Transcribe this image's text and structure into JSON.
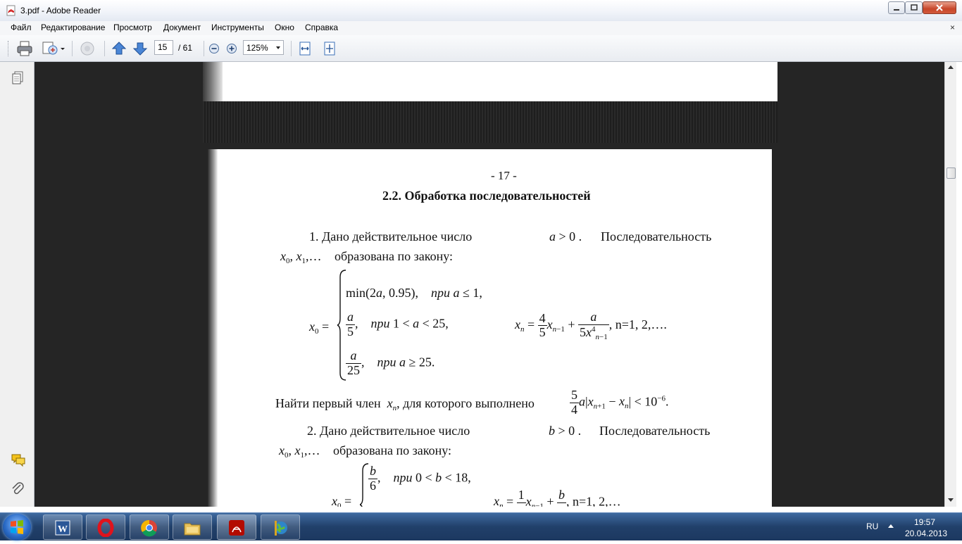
{
  "window": {
    "title": "3.pdf - Adobe Reader"
  },
  "menu": {
    "items": [
      "Файл",
      "Редактирование",
      "Просмотр",
      "Документ",
      "Инструменты",
      "Окно",
      "Справка"
    ],
    "close_glyph": "×"
  },
  "toolbar": {
    "page_current": "15",
    "page_total": "/ 61",
    "zoom": "125%",
    "icons": [
      "print-icon",
      "share-icon",
      "disabled-tool-icon",
      "prev-page-icon",
      "next-page-icon",
      "zoom-out-icon",
      "zoom-in-icon",
      "fit-width-icon",
      "fit-page-icon"
    ]
  },
  "document": {
    "page_number": "- 17 -",
    "heading": "2.2. Обработка последовательностей",
    "p1_line1": "1.   Дано   действительное   число",
    "p1_line1_end": "Последовательность",
    "p1_line2_text": "образована по закону:",
    "case1_text": "при",
    "find_text": "Найти первый член",
    "find_text2": ", для которого выполнено",
    "p2_line1": "2.   Дано   действительное   число",
    "p2_line1_end": "Последовательность",
    "p2_line2_text": "образована по закону:",
    "n_range": "n=1, 2,….",
    "n_range2": "n=1, 2,…"
  },
  "taskbar": {
    "apps": [
      "word-icon",
      "opera-icon",
      "chrome-icon",
      "explorer-icon",
      "adobe-reader-icon",
      "app-globe-icon"
    ],
    "language": "RU",
    "time": "19:57",
    "date": "20.04.2013"
  },
  "colors": {
    "taskbar": "#21406a",
    "viewer_bg": "#252525",
    "close_button": "#c7462a"
  }
}
